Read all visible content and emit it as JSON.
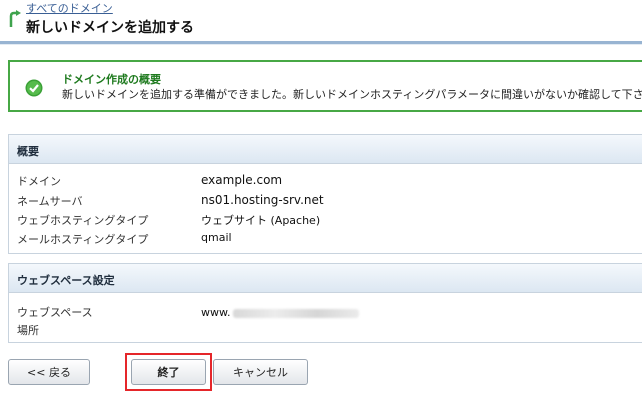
{
  "header": {
    "breadcrumb": "すべてのドメイン",
    "title": "新しいドメインを追加する"
  },
  "message": {
    "title": "ドメイン作成の概要",
    "text": "新しいドメインを追加する準備ができました。新しいドメインホスティングパラメータに間違いがないか確認して下さい"
  },
  "summary": {
    "heading": "概要",
    "rows": [
      {
        "label": "ドメイン",
        "value": "example.com"
      },
      {
        "label": "ネームサーバ",
        "value": "ns01.hosting-srv.net"
      },
      {
        "label": "ウェブホスティングタイプ",
        "value": "ウェブサイト (Apache)"
      },
      {
        "label": "メールホスティングタイプ",
        "value": "qmail"
      }
    ]
  },
  "webspace": {
    "heading": "ウェブスペース設定",
    "label_line1": "ウェブスペース",
    "label_line2": "場所",
    "value_prefix": "www."
  },
  "buttons": {
    "back": "<< 戻る",
    "finish": "終了",
    "cancel": "キャンセル"
  },
  "colors": {
    "success_border": "#47a845",
    "highlight": "#e5262a",
    "header_line": "#98b4d2"
  }
}
